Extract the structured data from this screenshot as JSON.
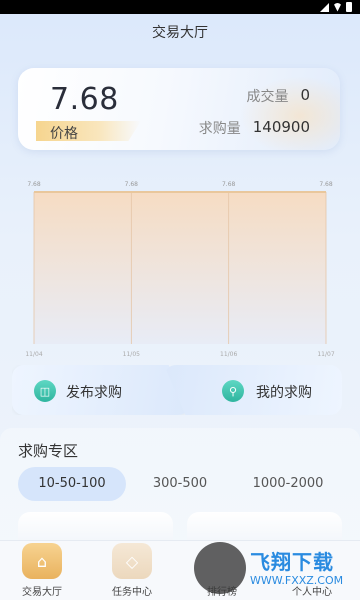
{
  "header": {
    "title": "交易大厅"
  },
  "price_card": {
    "price": "7.68",
    "price_label": "价格",
    "volume_label": "成交量",
    "volume_value": "0",
    "buy_label": "求购量",
    "buy_value": "140900"
  },
  "chart_data": {
    "type": "area",
    "x": [
      "11/04",
      "11/05",
      "11/06",
      "11/07"
    ],
    "series": [
      {
        "values": [
          7.68,
          7.68,
          7.68,
          7.68
        ]
      }
    ],
    "point_labels": [
      "7.68",
      "7.68",
      "7.68",
      "7.68"
    ],
    "colors": {
      "line": "#e9c79c",
      "fill_top": "#f6dcc3",
      "fill_bottom": "#e8ecf6"
    }
  },
  "actions": {
    "publish_label": "发布求购",
    "mine_label": "我的求购",
    "publish_icon": "cart-icon",
    "mine_icon": "search-icon"
  },
  "zone": {
    "title": "求购专区",
    "ranges": [
      "10-50-100",
      "300-500",
      "1000-2000"
    ],
    "active_range": "10-50-100"
  },
  "bottom_nav": {
    "items": [
      {
        "label": "交易大厅",
        "icon": "home-icon",
        "active": true
      },
      {
        "label": "任务中心",
        "icon": "gamepad-icon",
        "active": false
      },
      {
        "label": "排行榜",
        "icon": "ranking-icon",
        "active": false
      },
      {
        "label": "个人中心",
        "icon": "user-icon",
        "active": false
      }
    ]
  },
  "watermark": {
    "title": "飞翔下载",
    "url": "WWW.FXXZ.COM"
  }
}
